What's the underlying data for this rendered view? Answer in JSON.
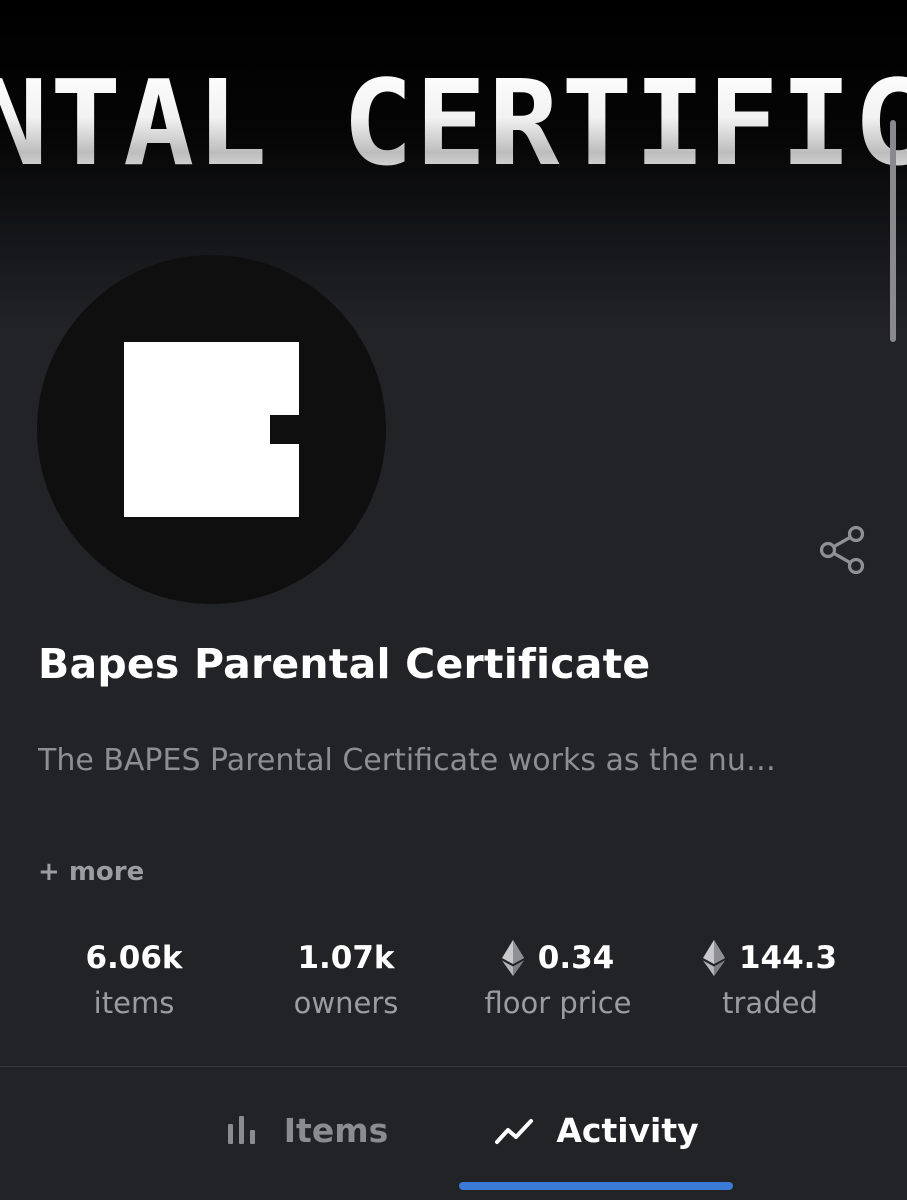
{
  "banner": {
    "text": "ENTAL CERTIFIC"
  },
  "collection": {
    "title": "Bapes Parental Certificate",
    "description": "The BAPES Parental Certificate works as the nu…",
    "more_label": "+ more"
  },
  "stats": [
    {
      "value": "6.06k",
      "label": "items",
      "icon": ""
    },
    {
      "value": "1.07k",
      "label": "owners",
      "icon": ""
    },
    {
      "value": "0.34",
      "label": "floor price",
      "icon": "ethereum-icon"
    },
    {
      "value": "144.3",
      "label": "traded",
      "icon": "ethereum-icon"
    }
  ],
  "tabs": [
    {
      "label": "Items",
      "icon": "bar-chart-icon",
      "active": false
    },
    {
      "label": "Activity",
      "icon": "trend-line-icon",
      "active": true
    }
  ],
  "colors": {
    "background": "#222327",
    "accent": "#3a7bd5",
    "muted_text": "#9a9ca2"
  }
}
